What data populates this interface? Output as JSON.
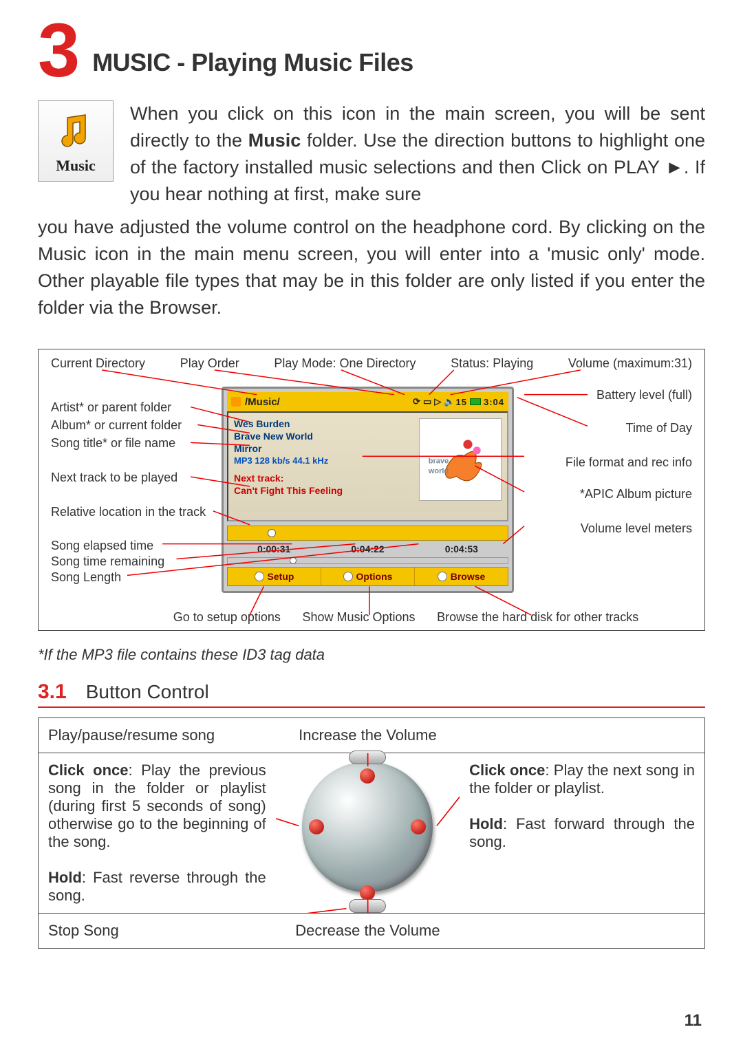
{
  "chapter": {
    "num": "3",
    "title": "MUSIC - Playing Music Files"
  },
  "music_icon_label": "Music",
  "intro_1": "When you click on this icon in the main screen, you will be sent directly to the ",
  "intro_bold": "Music",
  "intro_2": " folder. Use the direction buttons to highlight one of the factory installed music selections and then Click on PLAY ►. If you hear nothing at first, make sure ",
  "intro_cont": "you have adjusted the volume control on the headphone cord. By clicking on the Music icon in the main menu screen, you will enter into a 'music only' mode. Other playable file types that may be in this folder are only listed if you enter the folder via the Browser.",
  "top_labels": {
    "curdir": "Current Directory",
    "playorder": "Play Order",
    "mode": "Play Mode: One Directory",
    "status": "Status: Playing",
    "volume": "Volume (maximum:31)"
  },
  "left_labels": {
    "artist": "Artist* or parent folder",
    "album": "Album* or current folder",
    "title": "Song title* or file name",
    "next": "Next track to be played",
    "relloc": "Relative location in the track",
    "elapsed": "Song elapsed time",
    "remain": "Song time remaining",
    "length": "Song Length"
  },
  "right_labels": {
    "battery": "Battery level (full)",
    "tod": "Time of Day",
    "fmt": "File format and rec info",
    "apic": "*APIC Album picture",
    "meters": "Volume level meters"
  },
  "bottom_labels": {
    "setup": "Go to setup options",
    "opts": "Show Music Options",
    "browse": "Browse the hard disk for other tracks"
  },
  "device": {
    "path": "/Music/",
    "vol": "15",
    "clock": "3:04",
    "artist": "Wes Burden",
    "album": "Brave New World",
    "song": "Mirror",
    "format": "MP3 128 kb/s 44.1 kHz",
    "next_hdr": "Next track:",
    "next_song": "Can't Fight This Feeling",
    "t_elapsed": "0:00:31",
    "t_remain": "0:04:22",
    "t_total": "0:04:53",
    "sk_setup": "Setup",
    "sk_options": "Options",
    "sk_browse": "Browse",
    "art_caption_top": "brave",
    "art_caption_bot": "world"
  },
  "footnote": "*If the MP3 file contains these ID3 tag data",
  "subsection": {
    "num": "3.1",
    "title": "Button Control"
  },
  "btn": {
    "r1_left": "Play/pause/resume song",
    "r1_mid": "Increase the Volume",
    "r2_left_click_b": "Click once",
    "r2_left_click": ": Play the previous song in the folder or playlist (during first 5 seconds of song) otherwise go to the beginning of the song.",
    "r2_left_hold_b": "Hold",
    "r2_left_hold": ": Fast reverse through the song.",
    "r2_right_click_b": "Click once",
    "r2_right_click": ": Play the next song in the folder or playlist.",
    "r2_right_hold_b": "Hold",
    "r2_right_hold": ": Fast forward through the song.",
    "r3_left": "Stop Song",
    "r3_mid": "Decrease the Volume"
  },
  "page_num": "11"
}
